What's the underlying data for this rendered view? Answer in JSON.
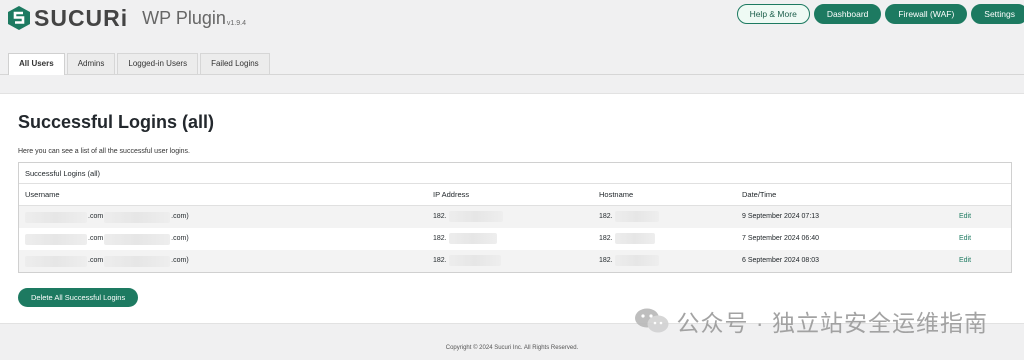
{
  "brand": {
    "name": "SUCURi",
    "product": "WP Plugin",
    "version": "v1.9.4",
    "accent": "#1d7a61"
  },
  "topnav": [
    {
      "label": "Help & More",
      "style": "outline"
    },
    {
      "label": "Dashboard",
      "style": "solid"
    },
    {
      "label": "Firewall (WAF)",
      "style": "solid"
    },
    {
      "label": "Settings",
      "style": "solid"
    }
  ],
  "tabs": [
    {
      "label": "All Users",
      "active": true
    },
    {
      "label": "Admins",
      "active": false
    },
    {
      "label": "Logged-in Users",
      "active": false
    },
    {
      "label": "Failed Logins",
      "active": false
    }
  ],
  "page": {
    "title": "Successful Logins (all)",
    "description": "Here you can see a list of all the successful user logins."
  },
  "table": {
    "caption": "Successful Logins (all)",
    "columns": [
      "Username",
      "IP Address",
      "Hostname",
      "Date/Time"
    ],
    "rows": [
      {
        "user_a": ".com",
        "user_b": ".com)",
        "ip": "182.",
        "host": "182.",
        "date": "9 September 2024 07:13",
        "action": "Edit"
      },
      {
        "user_a": ".com",
        "user_b": ".com)",
        "ip": "182.",
        "host": "182.",
        "date": "7 September 2024 06:40",
        "action": "Edit"
      },
      {
        "user_a": ".com",
        "user_b": ".com)",
        "ip": "182.",
        "host": "182.",
        "date": "6 September 2024 08:03",
        "action": "Edit"
      }
    ]
  },
  "delete_button": "Delete All Successful Logins",
  "footer": "Copyright © 2024 Sucuri Inc. All Rights Reserved.",
  "watermark": "公众号 · 独立站安全运维指南"
}
